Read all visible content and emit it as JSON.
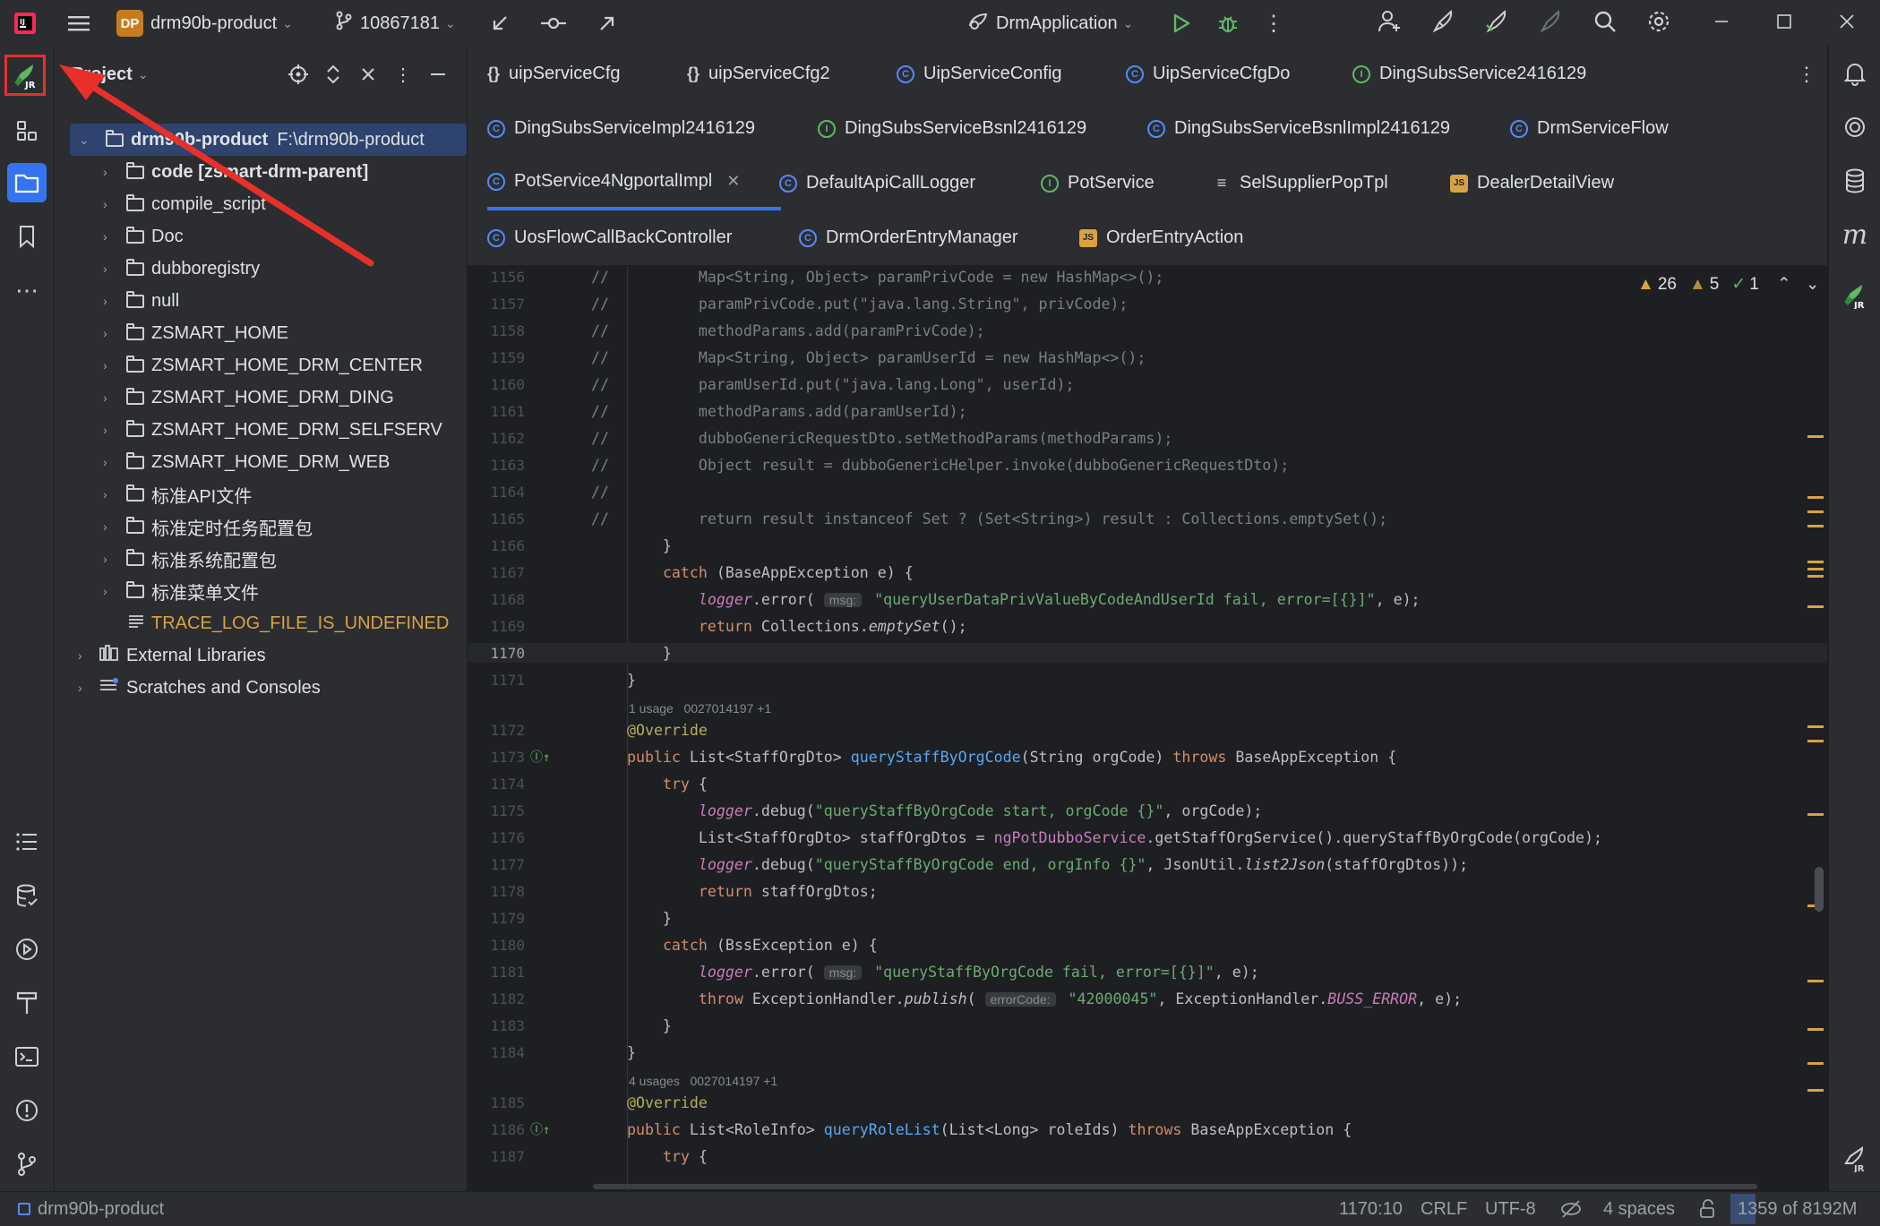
{
  "titlebar": {
    "project_badge": "DP",
    "project_name": "drm90b-product",
    "branch": "10867181",
    "run_config": "DrmApplication"
  },
  "project_panel": {
    "title": "Project",
    "tree": [
      {
        "label": "drm90b-product",
        "path": "F:\\drm90b-product",
        "level": 0,
        "expanded": true,
        "bold": true
      },
      {
        "label": "code [zsmart-drm-parent]",
        "level": 1,
        "bold": true
      },
      {
        "label": "compile_script",
        "level": 1
      },
      {
        "label": "Doc",
        "level": 1
      },
      {
        "label": "dubboregistry",
        "level": 1
      },
      {
        "label": "null",
        "level": 1
      },
      {
        "label": "ZSMART_HOME",
        "level": 1
      },
      {
        "label": "ZSMART_HOME_DRM_CENTER",
        "level": 1
      },
      {
        "label": "ZSMART_HOME_DRM_DING",
        "level": 1
      },
      {
        "label": "ZSMART_HOME_DRM_SELFSERV",
        "level": 1
      },
      {
        "label": "ZSMART_HOME_DRM_WEB",
        "level": 1
      },
      {
        "label": "标准API文件",
        "level": 1
      },
      {
        "label": "标准定时任务配置包",
        "level": 1
      },
      {
        "label": "标准系统配置包",
        "level": 1
      },
      {
        "label": "标准菜单文件",
        "level": 1
      },
      {
        "label": "TRACE_LOG_FILE_IS_UNDEFINED",
        "level": 1,
        "file": true
      },
      {
        "label": "External Libraries",
        "level": 0
      },
      {
        "label": "Scratches and Consoles",
        "level": 0
      }
    ]
  },
  "tabs": {
    "row1": [
      {
        "label": "uipServiceCfg",
        "icon": "json"
      },
      {
        "label": "uipServiceCfg2",
        "icon": "json"
      },
      {
        "label": "UipServiceConfig",
        "icon": "class"
      },
      {
        "label": "UipServiceCfgDo",
        "icon": "class"
      },
      {
        "label": "DingSubsService2416129",
        "icon": "interface"
      }
    ],
    "row2": [
      {
        "label": "DingSubsServiceImpl2416129",
        "icon": "class"
      },
      {
        "label": "DingSubsServiceBsnl2416129",
        "icon": "interface"
      },
      {
        "label": "DingSubsServiceBsnlImpl2416129",
        "icon": "class"
      },
      {
        "label": "DrmServiceFlow",
        "icon": "class"
      }
    ],
    "row3": [
      {
        "label": "PotService4NgportalImpl",
        "icon": "class",
        "active": true
      },
      {
        "label": "DefaultApiCallLogger",
        "icon": "class"
      },
      {
        "label": "PotService",
        "icon": "interface"
      },
      {
        "label": "SelSupplierPopTpl",
        "icon": "list"
      },
      {
        "label": "DealerDetailView",
        "icon": "js"
      }
    ],
    "row4": [
      {
        "label": "UosFlowCallBackController",
        "icon": "class"
      },
      {
        "label": "DrmOrderEntryManager",
        "icon": "class"
      },
      {
        "label": "OrderEntryAction",
        "icon": "js"
      }
    ]
  },
  "inspections": {
    "warnings": "26",
    "weak_warnings": "5",
    "typos": "1"
  },
  "code": {
    "lines": [
      {
        "n": "1156",
        "t": "//          Map<String, Object> paramPrivCode = new HashMap<>();",
        "k": "comment"
      },
      {
        "n": "1157",
        "t": "//          paramPrivCode.put(\"java.lang.String\", privCode);",
        "k": "comment"
      },
      {
        "n": "1158",
        "t": "//          methodParams.add(paramPrivCode);",
        "k": "comment"
      },
      {
        "n": "1159",
        "t": "//          Map<String, Object> paramUserId = new HashMap<>();",
        "k": "comment"
      },
      {
        "n": "1160",
        "t": "//          paramUserId.put(\"java.lang.Long\", userId);",
        "k": "comment"
      },
      {
        "n": "1161",
        "t": "//          methodParams.add(paramUserId);",
        "k": "comment"
      },
      {
        "n": "1162",
        "t": "//          dubboGenericRequestDto.setMethodParams(methodParams);",
        "k": "comment"
      },
      {
        "n": "1163",
        "t": "//          Object result = dubboGenericHelper.invoke(dubboGenericRequestDto);",
        "k": "comment"
      },
      {
        "n": "1164",
        "t": "//",
        "k": "comment"
      },
      {
        "n": "1165",
        "t": "//          return result instanceof Set ? (Set<String>) result : Collections.emptySet();",
        "k": "comment"
      },
      {
        "n": "1166",
        "t": "        }"
      },
      {
        "n": "1167",
        "t": "        catch (BaseAppException e) {"
      },
      {
        "n": "1168",
        "t": "            logger.error( msg: \"queryUserDataPrivValueByCodeAndUserId fail, error=[{}]\", e);"
      },
      {
        "n": "1169",
        "t": "            return Collections.emptySet();"
      },
      {
        "n": "1170",
        "t": "        }"
      },
      {
        "n": "1171",
        "t": "    }"
      },
      {
        "n": "",
        "t": "1 usage   0027014197 +1",
        "k": "inlay"
      },
      {
        "n": "1172",
        "t": "    @Override"
      },
      {
        "n": "1173",
        "t": "    public List<StaffOrgDto> queryStaffByOrgCode(String orgCode) throws BaseAppException {"
      },
      {
        "n": "1174",
        "t": "        try {"
      },
      {
        "n": "1175",
        "t": "            logger.debug(\"queryStaffByOrgCode start, orgCode {}\", orgCode);"
      },
      {
        "n": "1176",
        "t": "            List<StaffOrgDto> staffOrgDtos = ngPotDubboService.getStaffOrgService().queryStaffByOrgCode(orgCode);"
      },
      {
        "n": "1177",
        "t": "            logger.debug(\"queryStaffByOrgCode end, orgInfo {}\", JsonUtil.list2Json(staffOrgDtos));"
      },
      {
        "n": "1178",
        "t": "            return staffOrgDtos;"
      },
      {
        "n": "1179",
        "t": "        }"
      },
      {
        "n": "1180",
        "t": "        catch (BssException e) {"
      },
      {
        "n": "1181",
        "t": "            logger.error( msg: \"queryStaffByOrgCode fail, error=[{}]\", e);"
      },
      {
        "n": "1182",
        "t": "            throw ExceptionHandler.publish( errorCode: \"42000045\", ExceptionHandler.BUSS_ERROR, e);"
      },
      {
        "n": "1183",
        "t": "        }"
      },
      {
        "n": "1184",
        "t": "    }"
      },
      {
        "n": "",
        "t": "4 usages   0027014197 +1",
        "k": "inlay"
      },
      {
        "n": "1185",
        "t": "    @Override"
      },
      {
        "n": "1186",
        "t": "    public List<RoleInfo> queryRoleList(List<Long> roleIds) throws BaseAppException {"
      },
      {
        "n": "1187",
        "t": "        try {"
      }
    ]
  },
  "statusbar": {
    "project": "drm90b-product",
    "position": "1170:10",
    "line_sep": "CRLF",
    "encoding": "UTF-8",
    "indent": "4 spaces",
    "memory": "1359 of 8192M"
  }
}
